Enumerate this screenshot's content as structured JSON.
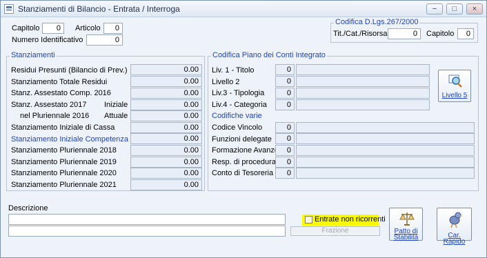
{
  "window": {
    "title": "Stanziamenti di Bilancio - Entrata / Interroga"
  },
  "controls": {
    "minimize": "−",
    "maximize": "□",
    "close": "×"
  },
  "header": {
    "capitolo_label": "Capitolo",
    "capitolo_value": "0",
    "articolo_label": "Articolo",
    "articolo_value": "0",
    "numero_label": "Numero Identificativo",
    "numero_value": "0"
  },
  "dlgs": {
    "title": "Codifica D.Lgs.267/2000",
    "tit_label": "Tit./Cat./Risorsa",
    "tit_value": "0",
    "capitolo_label": "Capitolo",
    "capitolo_value": "0"
  },
  "stanziamenti": {
    "title": "Stanziamenti",
    "rows": [
      {
        "label": "Residui Presunti (Bilancio di Prev.)",
        "value": "0.00"
      },
      {
        "label": "Stanziamento Totale Residui",
        "value": "0.00"
      },
      {
        "label": "Stanz. Assestato Comp. 2016",
        "value": "0.00"
      },
      {
        "label": "Stanz. Assestato 2017",
        "value": "0.00",
        "sub": "Iniziale"
      },
      {
        "label": "nel Pluriennale 2016",
        "value": "0.00",
        "sub": "Attuale"
      },
      {
        "label": "Stanziamento Iniziale di Cassa",
        "value": "0.00"
      },
      {
        "label": "Stanziamento Iniziale Competenza",
        "value": "0.00"
      },
      {
        "label": "Stanziamento Pluriennale 2018",
        "value": "0.00"
      },
      {
        "label": "Stanziamento Pluriennale 2019",
        "value": "0.00"
      },
      {
        "label": "Stanziamento Pluriennale 2020",
        "value": "0.00"
      },
      {
        "label": "Stanziamento Pluriennale 2021",
        "value": "0.00"
      }
    ]
  },
  "piano": {
    "title": "Codifica Piano dei Conti Integrato",
    "rows": [
      {
        "label": "Liv. 1 - Titolo",
        "code": "0",
        "desc": ""
      },
      {
        "label": "Livello 2",
        "code": "0",
        "desc": ""
      },
      {
        "label": "Liv.3 - Tipologia",
        "code": "0",
        "desc": ""
      },
      {
        "label": "Liv.4 - Categoria",
        "code": "0",
        "desc": ""
      }
    ],
    "button": "Livello 5"
  },
  "varie": {
    "title": "Codifiche varie",
    "rows": [
      {
        "label": "Codice Vincolo",
        "code": "0",
        "desc": ""
      },
      {
        "label": "Funzioni delegate",
        "code": "0",
        "desc": ""
      },
      {
        "label": "Formazione Avanzo",
        "code": "0",
        "desc": ""
      },
      {
        "label": "Resp. di procedura",
        "code": "0",
        "desc": ""
      },
      {
        "label": "Conto di Tesoreria",
        "code": "0",
        "desc": ""
      }
    ]
  },
  "descrizione": {
    "label": "Descrizione",
    "line1": "",
    "line2": ""
  },
  "entrate": {
    "label": "Entrate non ricorrenti"
  },
  "frazione": {
    "label": "Frazione"
  },
  "buttons": {
    "patto_line1": "Patto di",
    "patto_line2": "Stabilità",
    "car_rapido": "Car. Rapido"
  },
  "colors": {
    "accent_blue": "#1f42c5",
    "highlight": "#fbfb00",
    "window_bg": "#eef3fa"
  }
}
